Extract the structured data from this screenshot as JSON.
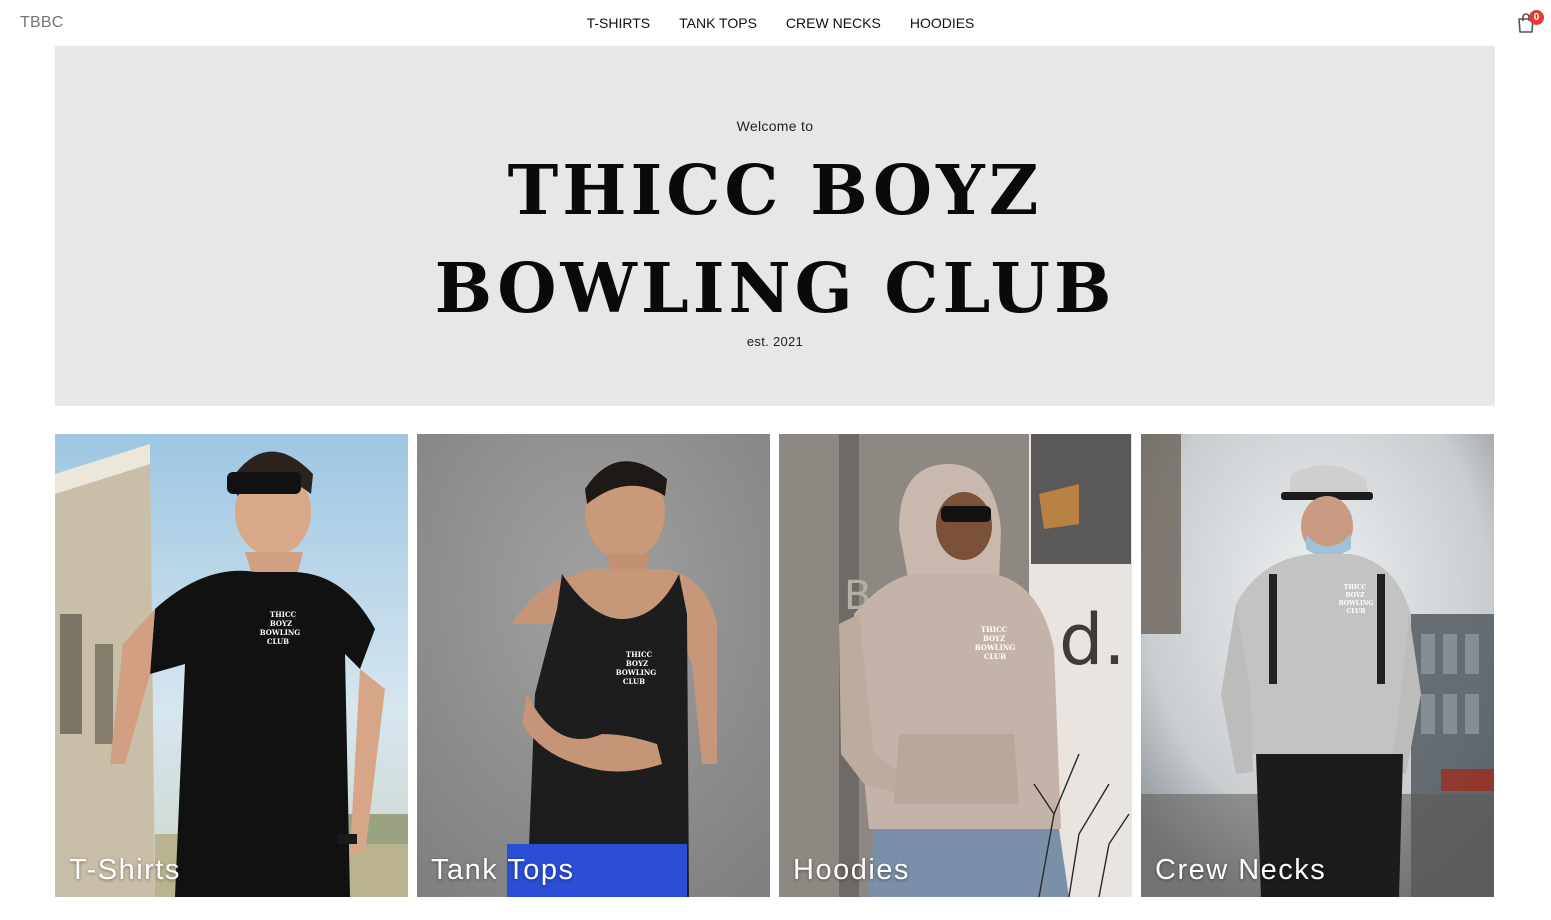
{
  "header": {
    "brand": "TBBC",
    "nav": [
      {
        "label": "T-SHIRTS"
      },
      {
        "label": "TANK TOPS"
      },
      {
        "label": "CREW NECKS"
      },
      {
        "label": "HOODIES"
      }
    ],
    "cart": {
      "icon": "shopping-bag-icon",
      "count": "0",
      "badge_color": "#e53935"
    }
  },
  "hero": {
    "welcome": "Welcome to",
    "title_line1": "THICC BOYZ",
    "title_line2": "BOWLING CLUB",
    "est": "est. 2021",
    "background": "#e7e7e7"
  },
  "categories": [
    {
      "label": "T-Shirts",
      "print": "THICC BOYZ BOWLING CLUB"
    },
    {
      "label": "Tank Tops",
      "print": "THICC BOYZ BOWLING CLUB"
    },
    {
      "label": "Hoodies",
      "print": "THICC BOYZ BOWLING CLUB"
    },
    {
      "label": "Crew Necks",
      "print": "THICC BOYZ BOWLING CLUB"
    }
  ]
}
